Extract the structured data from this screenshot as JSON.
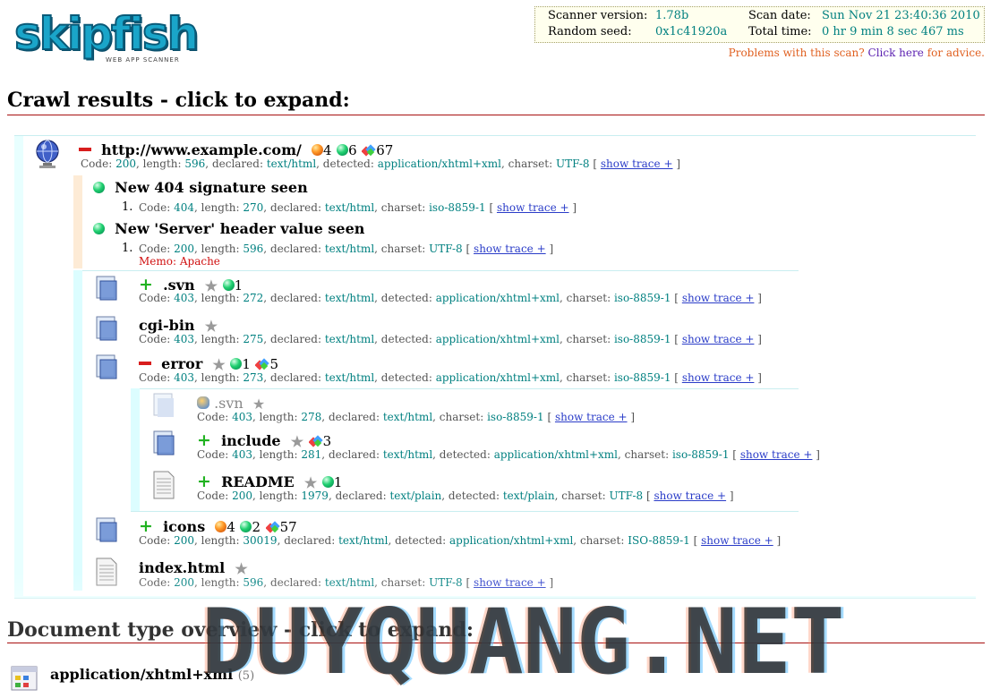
{
  "logo": {
    "text": "skipfish",
    "subtitle": "WEB APP SCANNER"
  },
  "scan_info": {
    "scanner_version_label": "Scanner version:",
    "scanner_version": "1.78b",
    "random_seed_label": "Random seed:",
    "random_seed": "0x1c41920a",
    "scan_date_label": "Scan date:",
    "scan_date": "Sun Nov 21 23:40:36 2010",
    "total_time_label": "Total time:",
    "total_time": "0 hr 9 min 8 sec 467 ms"
  },
  "problems": {
    "prefix": "Problems with this scan?",
    "link": "Click here",
    "suffix": "for advice."
  },
  "crawl_heading": "Crawl results - click to expand:",
  "doctype_heading": "Document type overview - click to expand:",
  "labels": {
    "code": "Code:",
    "length": "length:",
    "declared": "declared:",
    "detected": "detected:",
    "charset": "charset:",
    "show_trace": "show trace +",
    "lb": "[",
    "rb": "]"
  },
  "root": {
    "url": "http://www.example.com/",
    "count_orange": "4",
    "count_green": "6",
    "count_multi": "67",
    "code": "200",
    "length": "596",
    "declared": "text/html",
    "detected": "application/xhtml+xml",
    "charset": "UTF-8"
  },
  "issues": [
    {
      "title": "New 404 signature seen",
      "num": "1.",
      "code": "404",
      "length": "270",
      "declared": "text/html",
      "charset": "iso-8859-1",
      "memo": ""
    },
    {
      "title": "New 'Server' header value seen",
      "num": "1.",
      "code": "200",
      "length": "596",
      "declared": "text/html",
      "charset": "UTF-8",
      "memo": "Memo: Apache"
    }
  ],
  "children": [
    {
      "name": ".svn",
      "c1": "1",
      "c2": "",
      "code": "403",
      "length": "272",
      "declared": "text/html",
      "detected": "application/xhtml+xml",
      "charset": "iso-8859-1"
    },
    {
      "name": "cgi-bin",
      "c1": "",
      "c2": "",
      "code": "403",
      "length": "275",
      "declared": "text/html",
      "detected": "application/xhtml+xml",
      "charset": "iso-8859-1"
    },
    {
      "name": "error",
      "c1": "1",
      "c2": "5",
      "code": "403",
      "length": "273",
      "declared": "text/html",
      "detected": "application/xhtml+xml",
      "charset": "iso-8859-1"
    },
    {
      "name": "icons",
      "c0": "4",
      "c1": "2",
      "c2": "57",
      "code": "200",
      "length": "30019",
      "declared": "text/html",
      "detected": "application/xhtml+xml",
      "charset": "ISO-8859-1"
    },
    {
      "name": "index.html",
      "code": "200",
      "length": "596",
      "declared": "text/html",
      "charset": "UTF-8"
    }
  ],
  "error_children": [
    {
      "name": ".svn",
      "code": "403",
      "length": "278",
      "declared": "text/html",
      "charset": "iso-8859-1"
    },
    {
      "name": "include",
      "c2": "3",
      "code": "403",
      "length": "281",
      "declared": "text/html",
      "detected": "application/xhtml+xml",
      "charset": "iso-8859-1"
    },
    {
      "name": "README",
      "c1": "1",
      "code": "200",
      "length": "1979",
      "declared": "text/plain",
      "detected": "text/plain",
      "charset": "UTF-8"
    }
  ],
  "doctypes": [
    {
      "name": "application/xhtml+xml",
      "count": "(5)"
    }
  ],
  "watermark": "DUYQUANG.NET",
  "colors": {
    "teal": "#008080",
    "link": "#2a3cc8",
    "rule": "#a81010",
    "issue_bg": "#fdebd6",
    "panel_bg": "#e6ffff"
  }
}
